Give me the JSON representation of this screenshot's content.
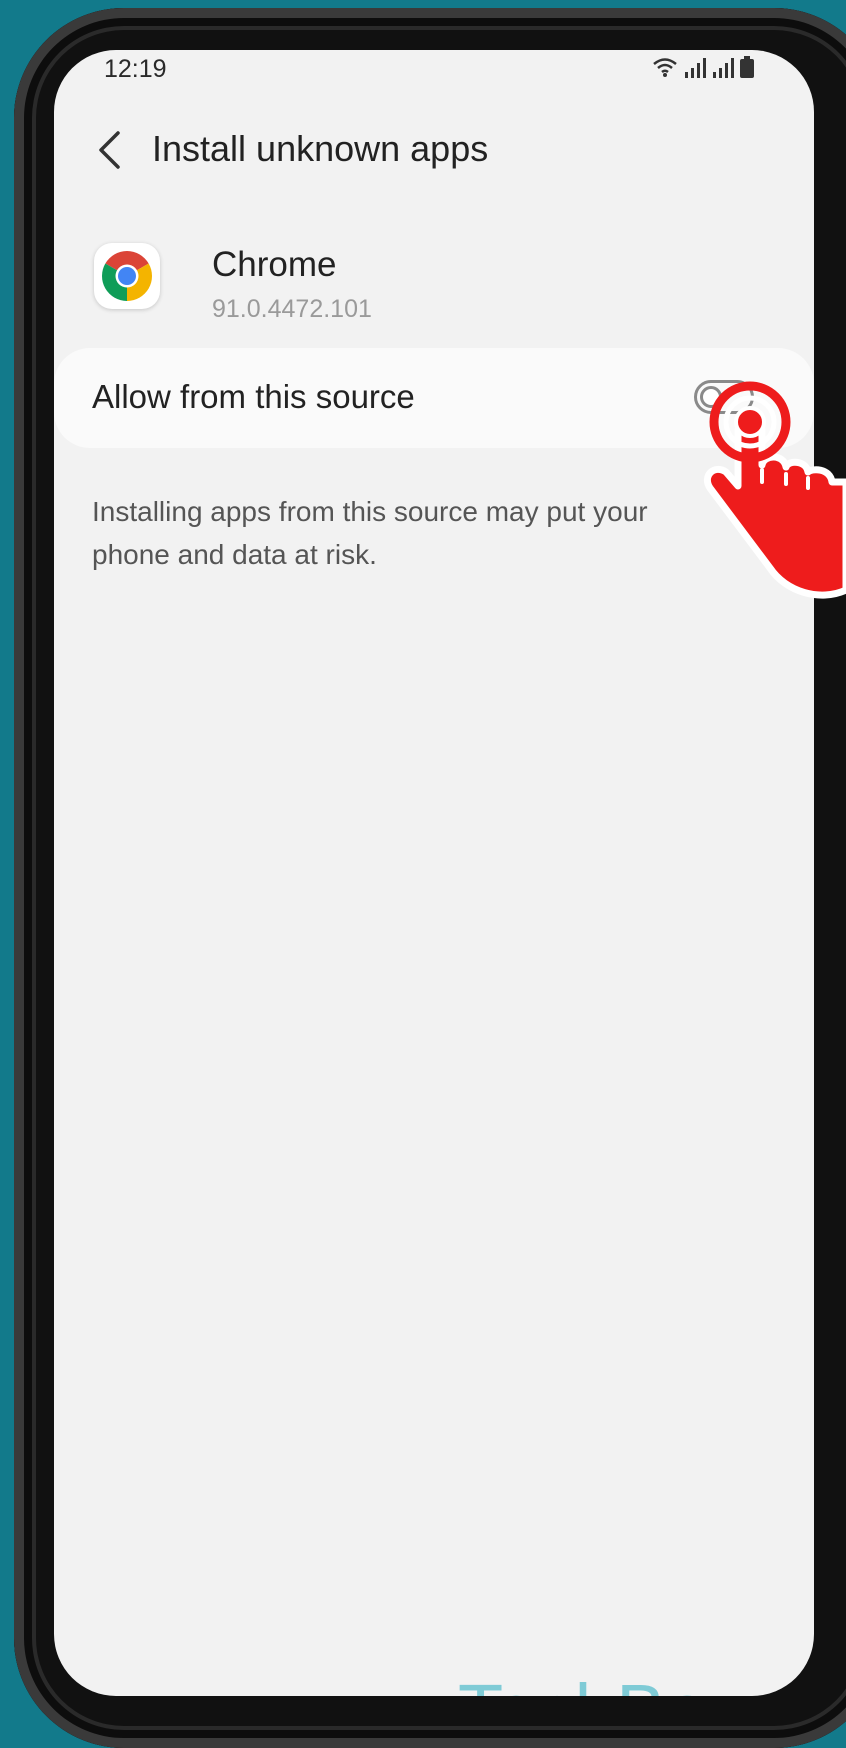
{
  "status_bar": {
    "time": "12:19",
    "icons": [
      "wifi-icon",
      "signal-icon",
      "signal-icon",
      "battery-icon"
    ]
  },
  "header": {
    "title": "Install unknown apps",
    "back_icon": "chevron-left-icon"
  },
  "app": {
    "name": "Chrome",
    "version": "91.0.4472.101",
    "icon": "chrome-icon"
  },
  "setting": {
    "label": "Allow from this source",
    "enabled": false
  },
  "description": "Installing apps from this source may put your phone and data at risk.",
  "watermark": "TechBone",
  "colors": {
    "background": "#127a8b",
    "screen": "#f2f2f2",
    "card": "#fafafa",
    "tap_indicator": "#ee1c1c",
    "watermark": "#7fcbd6"
  }
}
